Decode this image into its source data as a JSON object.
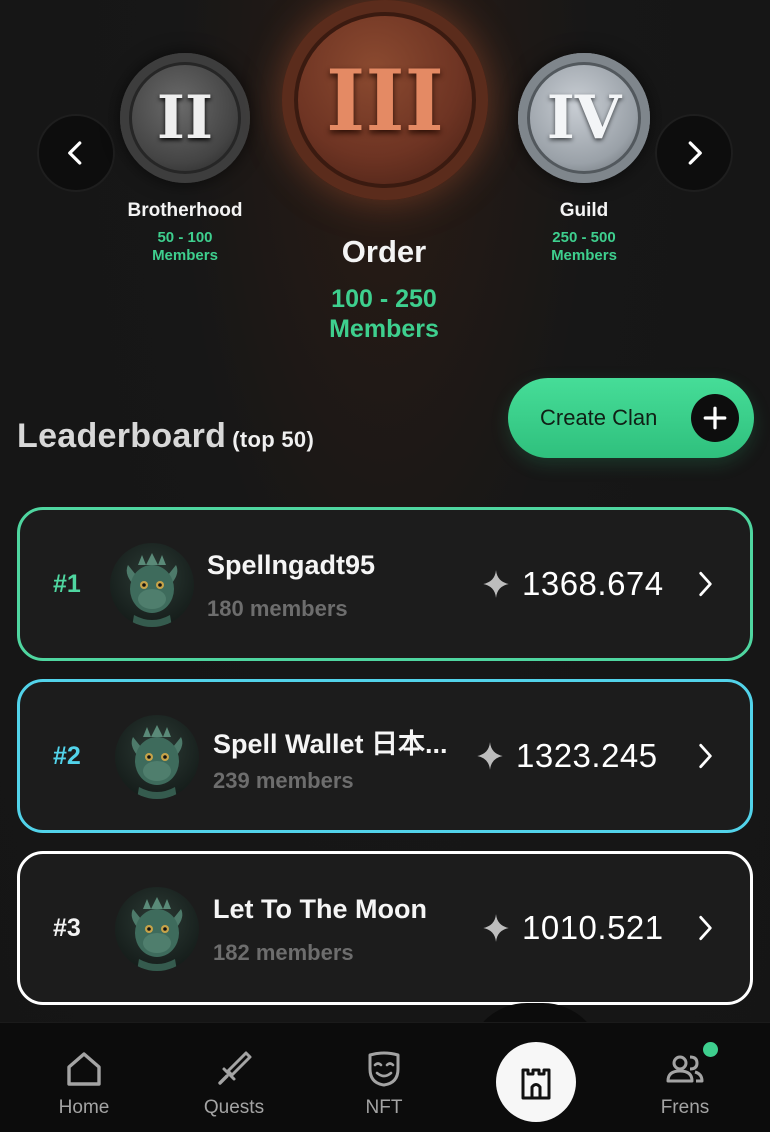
{
  "tiers": {
    "left": {
      "numeral": "II",
      "name": "Brotherhood",
      "range": "50 - 100",
      "unit": "Members"
    },
    "center": {
      "numeral": "III",
      "name": "Order",
      "range": "100 - 250",
      "unit": "Members"
    },
    "right": {
      "numeral": "IV",
      "name": "Guild",
      "range": "250 - 500",
      "unit": "Members"
    }
  },
  "leaderboard": {
    "title": "Leaderboard",
    "subtitle": "(top 50)",
    "create_label": "Create Clan",
    "rows": [
      {
        "rank": "#1",
        "name": "Spellngadt95",
        "members": "180 members",
        "score": "1368.674"
      },
      {
        "rank": "#2",
        "name": "Spell Wallet 日本...",
        "members": "239 members",
        "score": "1323.245"
      },
      {
        "rank": "#3",
        "name": "Let To The Moon",
        "members": "182 members",
        "score": "1010.521"
      }
    ]
  },
  "nav": {
    "home": "Home",
    "quests": "Quests",
    "nft": "NFT",
    "frens": "Frens"
  },
  "colors": {
    "accent_green": "#3ecf8e",
    "rank1_border": "#4fd6a0",
    "rank2_border": "#52d3ea",
    "rank3_border": "#ffffff",
    "background": "#161616"
  },
  "icons": {
    "prev": "chevron-left-icon",
    "next": "chevron-right-icon",
    "create": "plus-icon",
    "score": "sparkle-icon",
    "row_action": "chevron-right-icon",
    "home": "home-icon",
    "quests": "sword-icon",
    "nft": "mask-icon",
    "center": "castle-icon",
    "frens": "users-icon"
  }
}
